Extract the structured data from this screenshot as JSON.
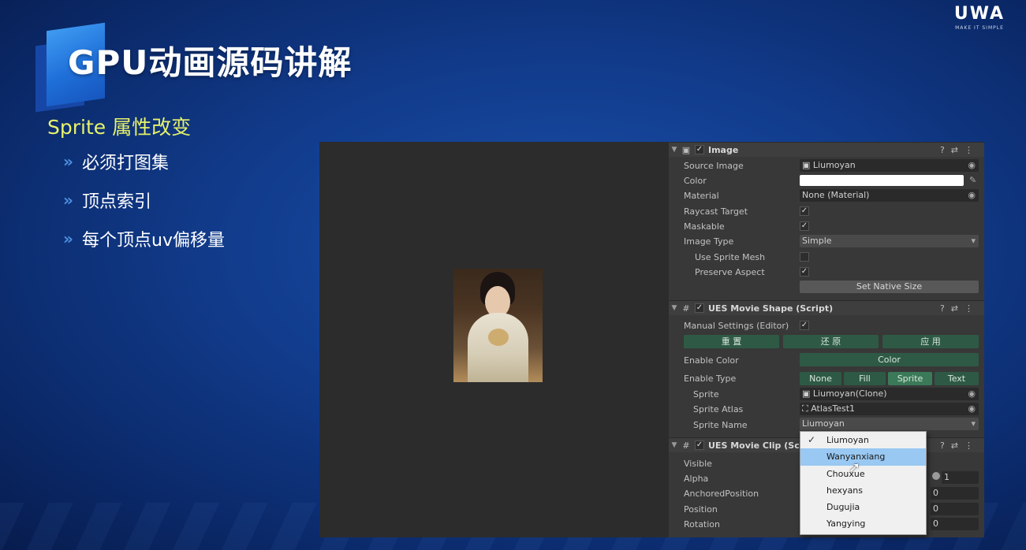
{
  "slide": {
    "title": "GPU动画源码讲解",
    "brand_name": "UWA",
    "brand_tagline": "MAKE IT SIMPLE",
    "subtitle": "Sprite 属性改变",
    "bullet_icon": "chevron-right-icon",
    "bullets": [
      "必须打图集",
      "顶点索引",
      "每个顶点uv偏移量"
    ]
  },
  "inspector": {
    "image_component": {
      "name": "Image",
      "enabled": true,
      "source_image_label": "Source Image",
      "source_image_value": "Liumoyan",
      "color_label": "Color",
      "color_value": "#ffffff",
      "material_label": "Material",
      "material_value": "None (Material)",
      "raycast_label": "Raycast Target",
      "raycast_value": true,
      "maskable_label": "Maskable",
      "maskable_value": true,
      "image_type_label": "Image Type",
      "image_type_value": "Simple",
      "use_sprite_mesh_label": "Use Sprite Mesh",
      "use_sprite_mesh_value": false,
      "preserve_aspect_label": "Preserve Aspect",
      "preserve_aspect_value": true,
      "set_native_size_label": "Set Native Size"
    },
    "movie_shape": {
      "name": "UES Movie Shape (Script)",
      "enabled": true,
      "manual_settings_label": "Manual Settings (Editor)",
      "manual_settings_value": true,
      "reset_label": "重 置",
      "restore_label": "还 原",
      "apply_label": "应 用",
      "enable_color_label": "Enable Color",
      "enable_color_button": "Color",
      "enable_type_label": "Enable Type",
      "enable_type_options": [
        "None",
        "Fill",
        "Sprite",
        "Text"
      ],
      "enable_type_selected": "Sprite",
      "sprite_label": "Sprite",
      "sprite_value": "Liumoyan(Clone)",
      "sprite_atlas_label": "Sprite Atlas",
      "sprite_atlas_value": "AtlasTest1",
      "sprite_name_label": "Sprite Name",
      "sprite_name_value": "Liumoyan"
    },
    "movie_clip": {
      "name": "UES Movie Clip (Sc",
      "enabled": true,
      "visible_label": "Visible",
      "alpha_label": "Alpha",
      "alpha_value": "1",
      "anchored_position_label": "AnchoredPosition",
      "anchored_position_value": "0",
      "position_label": "Position",
      "position_value": "0",
      "rotation_label": "Rotation",
      "rotation_value": "0"
    }
  },
  "sprite_name_dropdown": {
    "options": [
      "Liumoyan",
      "Wanyanxiang",
      "Chouxue",
      "hexyans",
      "Dugujia",
      "Yangying"
    ],
    "checked": "Liumoyan",
    "hovered": "Wanyanxiang"
  }
}
